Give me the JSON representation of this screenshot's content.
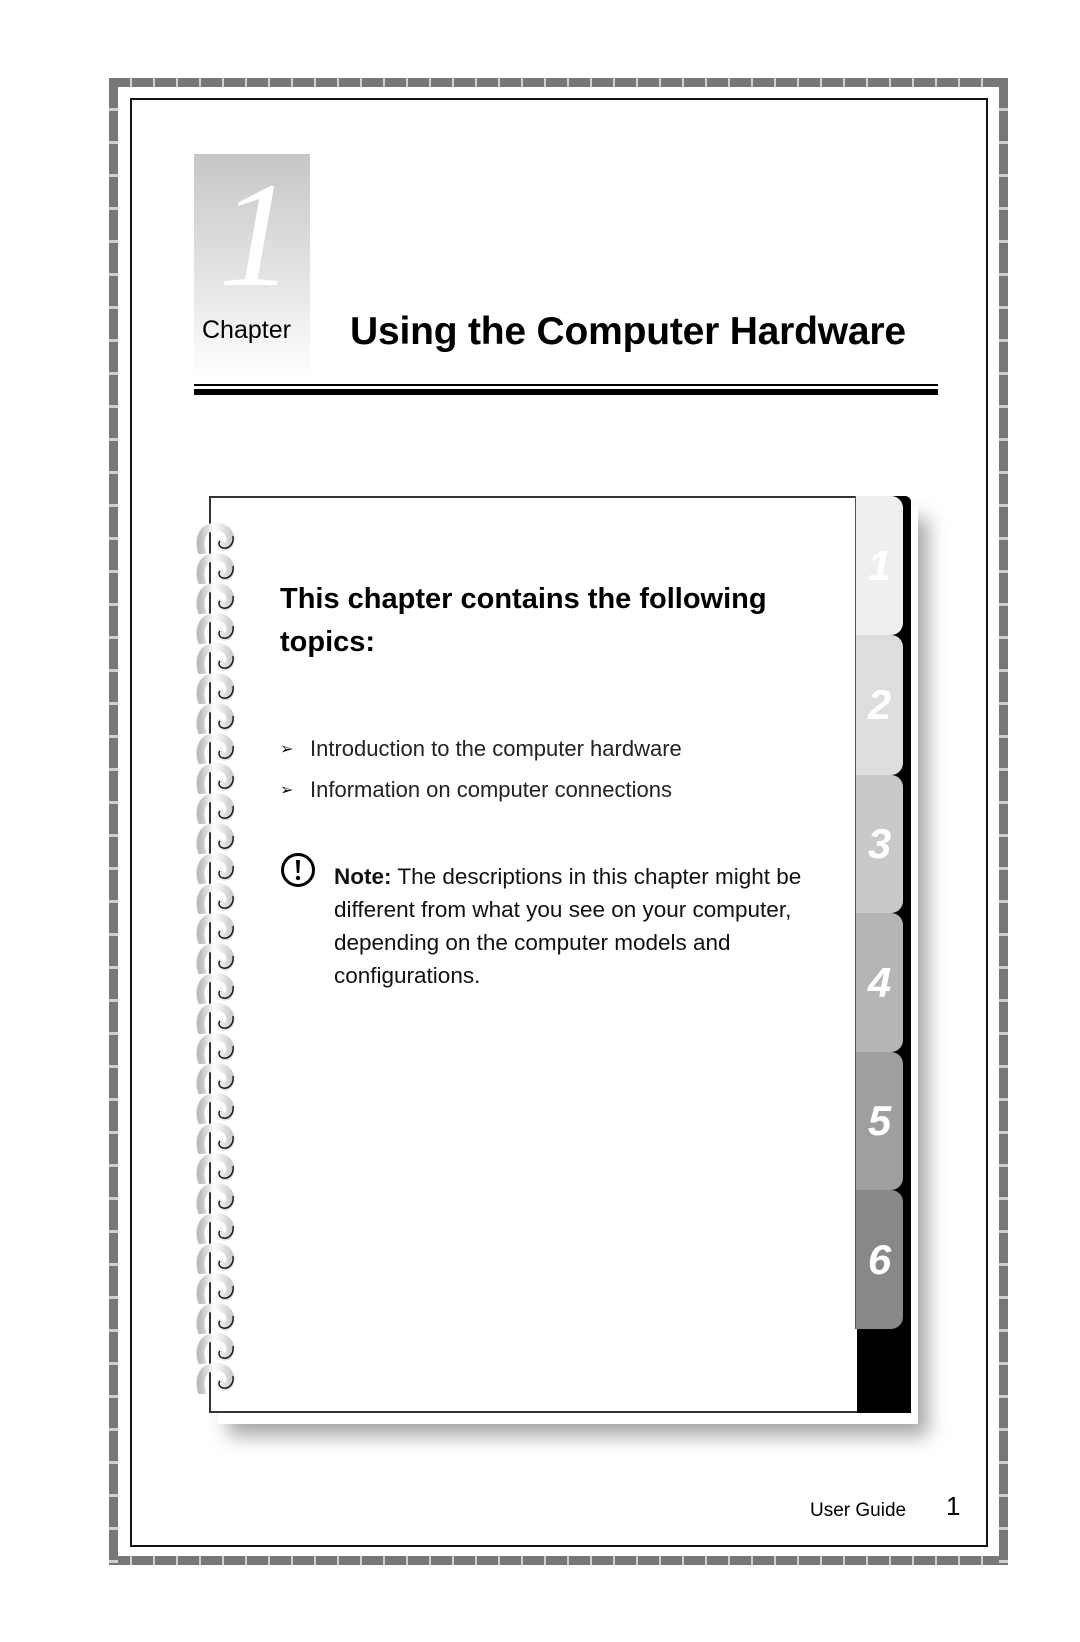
{
  "chapter": {
    "number": "1",
    "label": "Chapter",
    "title": "Using the Computer Hardware"
  },
  "notebook": {
    "heading": "This chapter contains the following topics:",
    "topics": [
      {
        "bullet_icon": "arrowhead-bullet-icon",
        "text": "Introduction to the computer hardware"
      },
      {
        "bullet_icon": "arrowhead-bullet-icon",
        "text": "Information on computer connections"
      }
    ],
    "note": {
      "icon": "exclamation-circle-icon",
      "label": "Note:",
      "text": " The descriptions in this chapter might be different from what you see on your computer, depending on the computer models and configurations."
    },
    "tabs": [
      {
        "label": "1",
        "color": "#eef0ef"
      },
      {
        "label": "2",
        "color": "#dcdddd"
      },
      {
        "label": "3",
        "color": "#c9c9c9"
      },
      {
        "label": "4",
        "color": "#b5b5b5"
      },
      {
        "label": "5",
        "color": "#9f9f9f"
      },
      {
        "label": "6",
        "color": "#888888"
      }
    ]
  },
  "footer": {
    "label": "User Guide",
    "page_number": "1"
  }
}
